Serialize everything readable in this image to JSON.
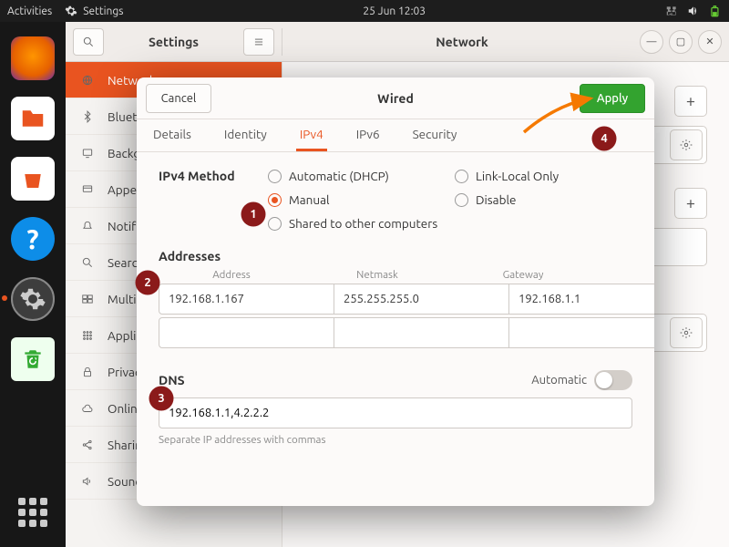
{
  "topbar": {
    "activities": "Activities",
    "appname": "Settings",
    "datetime": "25 Jun  12:03"
  },
  "settings": {
    "search_aria": "Search",
    "menu_aria": "Menu",
    "title_left": "Settings",
    "title_right": "Network",
    "sidebar": [
      {
        "id": "network",
        "label": "Network",
        "icon": "globe",
        "active": true
      },
      {
        "id": "bluetooth",
        "label": "Bluetooth",
        "icon": "bluetooth"
      },
      {
        "id": "background",
        "label": "Background",
        "icon": "display"
      },
      {
        "id": "appearance",
        "label": "Appearance",
        "icon": "appearance"
      },
      {
        "id": "notifications",
        "label": "Notifications",
        "icon": "bell"
      },
      {
        "id": "search",
        "label": "Search",
        "icon": "search"
      },
      {
        "id": "multitask",
        "label": "Multitasking",
        "icon": "multitask"
      },
      {
        "id": "applications",
        "label": "Applications",
        "icon": "grid"
      },
      {
        "id": "privacy",
        "label": "Privacy",
        "icon": "lock"
      },
      {
        "id": "online",
        "label": "Online Accounts",
        "icon": "cloud"
      },
      {
        "id": "sharing",
        "label": "Sharing",
        "icon": "share"
      },
      {
        "id": "sound",
        "label": "Sound",
        "icon": "sound"
      }
    ]
  },
  "dialog": {
    "cancel": "Cancel",
    "title": "Wired",
    "apply": "Apply",
    "tabs": [
      "Details",
      "Identity",
      "IPv4",
      "IPv6",
      "Security"
    ],
    "active_tab": 2,
    "ipv4": {
      "method_label": "IPv4 Method",
      "methods": {
        "auto": "Automatic (DHCP)",
        "manual": "Manual",
        "linklocal": "Link-Local Only",
        "disable": "Disable",
        "shared": "Shared to other computers"
      },
      "selected_method": "manual",
      "addresses_label": "Addresses",
      "addr_headers": {
        "addr": "Address",
        "mask": "Netmask",
        "gw": "Gateway"
      },
      "rows": [
        {
          "addr": "192.168.1.167",
          "mask": "255.255.255.0",
          "gw": "192.168.1.1"
        },
        {
          "addr": "",
          "mask": "",
          "gw": ""
        }
      ],
      "dns_label": "DNS",
      "dns_auto_label": "Automatic",
      "dns_auto_on": false,
      "dns_value": "192.168.1.1,4.2.2.2",
      "dns_hint": "Separate IP addresses with commas"
    }
  },
  "annotations": {
    "b1": "1",
    "b2": "2",
    "b3": "3",
    "b4": "4"
  }
}
